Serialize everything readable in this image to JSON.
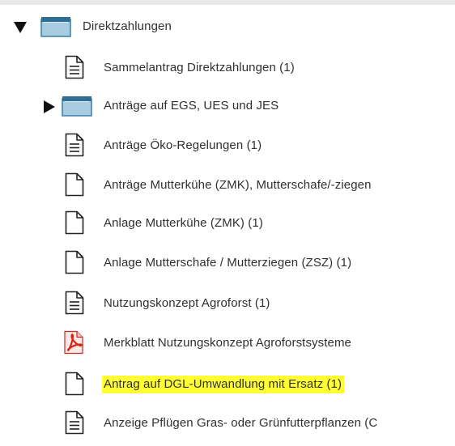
{
  "tree": {
    "root": {
      "label": "Direktzahlungen",
      "icon": "folder-icon",
      "expanded": true
    },
    "children": [
      {
        "label": "Sammelantrag Direktzahlungen (1)",
        "icon": "document-lines-icon"
      },
      {
        "label": "Anträge auf EGS, UES und JES",
        "icon": "folder-icon",
        "expanded": false
      },
      {
        "label": "Anträge Öko-Regelungen (1)",
        "icon": "document-lines-icon"
      },
      {
        "label": "Anträge Mutterkühe (ZMK), Mutterschafe/-ziegen",
        "icon": "document-blank-icon"
      },
      {
        "label": "Anlage Mutterkühe (ZMK) (1)",
        "icon": "document-blank-icon"
      },
      {
        "label": "Anlage Mutterschafe / Mutterziegen (ZSZ) (1)",
        "icon": "document-blank-icon"
      },
      {
        "label": "Nutzungskonzept Agroforst (1)",
        "icon": "document-lines-icon"
      },
      {
        "label": "Merkblatt Nutzungskonzept Agroforstsysteme",
        "icon": "pdf-icon"
      },
      {
        "label": "Antrag auf DGL-Umwandlung mit Ersatz (1)",
        "icon": "document-blank-icon",
        "highlighted": true
      },
      {
        "label": "Anzeige Pflügen Gras- oder Grünfutterpflanzen (C",
        "icon": "document-lines-icon"
      }
    ]
  },
  "colors": {
    "highlight": "#ffff33",
    "folder_fill": "#9fc6dc",
    "folder_top": "#2f6f95",
    "pdf_red": "#d9261c"
  }
}
